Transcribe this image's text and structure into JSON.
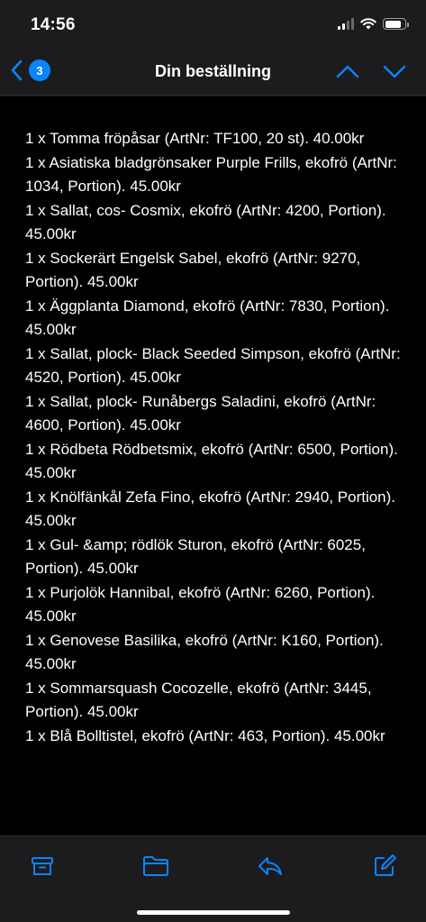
{
  "status_bar": {
    "time": "14:56",
    "battery_level": 0.85
  },
  "nav": {
    "back_icon": "chevron-left-icon",
    "back_badge": "3",
    "title": "Din beställning",
    "prev_icon": "chevron-up-icon",
    "next_icon": "chevron-down-icon"
  },
  "message": {
    "lines": [
      "1 x Tomma fröpåsar (ArtNr: TF100, 20 st). 40.00kr",
      "1 x Asiatiska bladgrönsaker Purple Frills, ekofrö (ArtNr: 1034, Portion). 45.00kr",
      "1 x Sallat, cos- Cosmix, ekofrö (ArtNr: 4200, Portion). 45.00kr",
      "1 x Sockerärt Engelsk Sabel, ekofrö (ArtNr: 9270, Portion). 45.00kr",
      "1 x Äggplanta Diamond, ekofrö (ArtNr: 7830, Portion). 45.00kr",
      "1 x Sallat, plock- Black Seeded Simpson, ekofrö (ArtNr: 4520, Portion). 45.00kr",
      "1 x Sallat, plock- Runåbergs Saladini, ekofrö (ArtNr: 4600, Portion). 45.00kr",
      "1 x Rödbeta Rödbetsmix, ekofrö (ArtNr: 6500, Portion). 45.00kr",
      "1 x Knölfänkål Zefa Fino, ekofrö (ArtNr: 2940, Portion). 45.00kr",
      "1 x Gul- &amp; rödlök Sturon, ekofrö (ArtNr: 6025, Portion). 45.00kr",
      "1 x Purjolök Hannibal, ekofrö (ArtNr: 6260, Portion). 45.00kr",
      "1 x Genovese Basilika, ekofrö (ArtNr: K160, Portion). 45.00kr",
      "1 x Sommarsquash Cocozelle, ekofrö (ArtNr: 3445, Portion). 45.00kr",
      "1 x Blå Bolltistel, ekofrö (ArtNr: 463, Portion). 45.00kr"
    ]
  },
  "toolbar": {
    "archive_icon": "archive-icon",
    "folder_icon": "folder-icon",
    "reply_icon": "reply-icon",
    "compose_icon": "compose-icon"
  },
  "colors": {
    "accent": "#0a84ff",
    "bar_background": "#1c1c1e",
    "content_background": "#000000"
  }
}
